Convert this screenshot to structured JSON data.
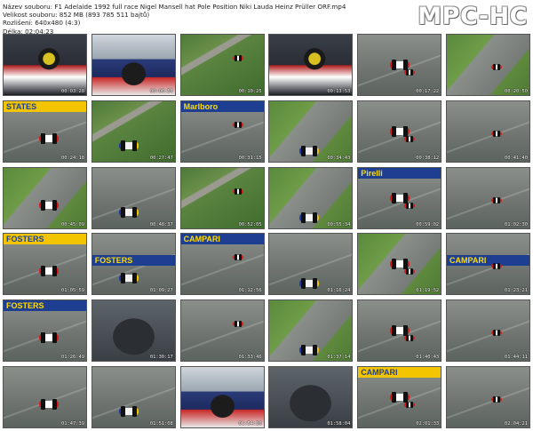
{
  "header": {
    "file_name": "Název souboru: F1 Adelaide 1992 full race Nigel Mansell hat Pole Position Niki Lauda Heinz Prüller ORF.mp4",
    "file_size": "Velikost souboru: 852 MB (893 785 511 bajtů)",
    "resolution": "Rozlišení: 640x480 (4:3)",
    "duration": "Délka: 02:04:23"
  },
  "logo": "MPC-HC",
  "thumbnails": [
    {
      "time": "00:03:28",
      "scene": "cockpit"
    },
    {
      "time": "00:06:56",
      "scene": "closeup"
    },
    {
      "time": "00:10:25",
      "scene": "aerial"
    },
    {
      "time": "00:13:53",
      "scene": "cockpit"
    },
    {
      "time": "00:17:22",
      "scene": "track"
    },
    {
      "time": "00:20:50",
      "scene": "grass"
    },
    {
      "time": "00:24:18",
      "scene": "track",
      "banner": "STATES"
    },
    {
      "time": "00:27:47",
      "scene": "aerial"
    },
    {
      "time": "00:31:15",
      "scene": "track",
      "banner": "Marlboro"
    },
    {
      "time": "00:34:43",
      "scene": "grass"
    },
    {
      "time": "00:38:12",
      "scene": "track"
    },
    {
      "time": "00:41:40",
      "scene": "track"
    },
    {
      "time": "00:45:09",
      "scene": "grass"
    },
    {
      "time": "00:48:37",
      "scene": "track"
    },
    {
      "time": "00:52:05",
      "scene": "aerial"
    },
    {
      "time": "00:55:34",
      "scene": "grass"
    },
    {
      "time": "00:59:02",
      "scene": "track",
      "banner": "Pirelli"
    },
    {
      "time": "01:02:30",
      "scene": "track"
    },
    {
      "time": "01:05:59",
      "scene": "track",
      "banner": "FOSTERS"
    },
    {
      "time": "01:09:27",
      "scene": "track",
      "banner": "FOSTERS"
    },
    {
      "time": "01:12:56",
      "scene": "track",
      "banner": "CAMPARI"
    },
    {
      "time": "01:16:24",
      "scene": "track"
    },
    {
      "time": "01:19:52",
      "scene": "grass"
    },
    {
      "time": "01:23:21",
      "scene": "track",
      "banner": "CAMPARI"
    },
    {
      "time": "01:26:49",
      "scene": "track",
      "banner": "FOSTERS"
    },
    {
      "time": "01:30:17",
      "scene": "dark"
    },
    {
      "time": "01:33:46",
      "scene": "track"
    },
    {
      "time": "01:37:14",
      "scene": "grass"
    },
    {
      "time": "01:40:43",
      "scene": "track"
    },
    {
      "time": "01:44:11",
      "scene": "track"
    },
    {
      "time": "01:47:39",
      "scene": "track"
    },
    {
      "time": "01:51:08",
      "scene": "track"
    },
    {
      "time": "01:54:36",
      "scene": "closeup"
    },
    {
      "time": "01:58:04",
      "scene": "dark"
    },
    {
      "time": "02:01:33",
      "scene": "track",
      "banner": "CAMPARI"
    },
    {
      "time": "02:04:21",
      "scene": "track"
    }
  ]
}
